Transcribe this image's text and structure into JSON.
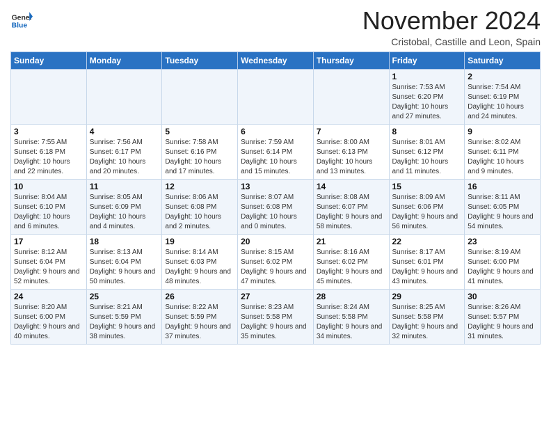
{
  "header": {
    "logo_general": "General",
    "logo_blue": "Blue",
    "month_title": "November 2024",
    "subtitle": "Cristobal, Castille and Leon, Spain"
  },
  "calendar": {
    "days_of_week": [
      "Sunday",
      "Monday",
      "Tuesday",
      "Wednesday",
      "Thursday",
      "Friday",
      "Saturday"
    ],
    "weeks": [
      [
        {
          "day": "",
          "info": ""
        },
        {
          "day": "",
          "info": ""
        },
        {
          "day": "",
          "info": ""
        },
        {
          "day": "",
          "info": ""
        },
        {
          "day": "",
          "info": ""
        },
        {
          "day": "1",
          "info": "Sunrise: 7:53 AM\nSunset: 6:20 PM\nDaylight: 10 hours and 27 minutes."
        },
        {
          "day": "2",
          "info": "Sunrise: 7:54 AM\nSunset: 6:19 PM\nDaylight: 10 hours and 24 minutes."
        }
      ],
      [
        {
          "day": "3",
          "info": "Sunrise: 7:55 AM\nSunset: 6:18 PM\nDaylight: 10 hours and 22 minutes."
        },
        {
          "day": "4",
          "info": "Sunrise: 7:56 AM\nSunset: 6:17 PM\nDaylight: 10 hours and 20 minutes."
        },
        {
          "day": "5",
          "info": "Sunrise: 7:58 AM\nSunset: 6:16 PM\nDaylight: 10 hours and 17 minutes."
        },
        {
          "day": "6",
          "info": "Sunrise: 7:59 AM\nSunset: 6:14 PM\nDaylight: 10 hours and 15 minutes."
        },
        {
          "day": "7",
          "info": "Sunrise: 8:00 AM\nSunset: 6:13 PM\nDaylight: 10 hours and 13 minutes."
        },
        {
          "day": "8",
          "info": "Sunrise: 8:01 AM\nSunset: 6:12 PM\nDaylight: 10 hours and 11 minutes."
        },
        {
          "day": "9",
          "info": "Sunrise: 8:02 AM\nSunset: 6:11 PM\nDaylight: 10 hours and 9 minutes."
        }
      ],
      [
        {
          "day": "10",
          "info": "Sunrise: 8:04 AM\nSunset: 6:10 PM\nDaylight: 10 hours and 6 minutes."
        },
        {
          "day": "11",
          "info": "Sunrise: 8:05 AM\nSunset: 6:09 PM\nDaylight: 10 hours and 4 minutes."
        },
        {
          "day": "12",
          "info": "Sunrise: 8:06 AM\nSunset: 6:08 PM\nDaylight: 10 hours and 2 minutes."
        },
        {
          "day": "13",
          "info": "Sunrise: 8:07 AM\nSunset: 6:08 PM\nDaylight: 10 hours and 0 minutes."
        },
        {
          "day": "14",
          "info": "Sunrise: 8:08 AM\nSunset: 6:07 PM\nDaylight: 9 hours and 58 minutes."
        },
        {
          "day": "15",
          "info": "Sunrise: 8:09 AM\nSunset: 6:06 PM\nDaylight: 9 hours and 56 minutes."
        },
        {
          "day": "16",
          "info": "Sunrise: 8:11 AM\nSunset: 6:05 PM\nDaylight: 9 hours and 54 minutes."
        }
      ],
      [
        {
          "day": "17",
          "info": "Sunrise: 8:12 AM\nSunset: 6:04 PM\nDaylight: 9 hours and 52 minutes."
        },
        {
          "day": "18",
          "info": "Sunrise: 8:13 AM\nSunset: 6:04 PM\nDaylight: 9 hours and 50 minutes."
        },
        {
          "day": "19",
          "info": "Sunrise: 8:14 AM\nSunset: 6:03 PM\nDaylight: 9 hours and 48 minutes."
        },
        {
          "day": "20",
          "info": "Sunrise: 8:15 AM\nSunset: 6:02 PM\nDaylight: 9 hours and 47 minutes."
        },
        {
          "day": "21",
          "info": "Sunrise: 8:16 AM\nSunset: 6:02 PM\nDaylight: 9 hours and 45 minutes."
        },
        {
          "day": "22",
          "info": "Sunrise: 8:17 AM\nSunset: 6:01 PM\nDaylight: 9 hours and 43 minutes."
        },
        {
          "day": "23",
          "info": "Sunrise: 8:19 AM\nSunset: 6:00 PM\nDaylight: 9 hours and 41 minutes."
        }
      ],
      [
        {
          "day": "24",
          "info": "Sunrise: 8:20 AM\nSunset: 6:00 PM\nDaylight: 9 hours and 40 minutes."
        },
        {
          "day": "25",
          "info": "Sunrise: 8:21 AM\nSunset: 5:59 PM\nDaylight: 9 hours and 38 minutes."
        },
        {
          "day": "26",
          "info": "Sunrise: 8:22 AM\nSunset: 5:59 PM\nDaylight: 9 hours and 37 minutes."
        },
        {
          "day": "27",
          "info": "Sunrise: 8:23 AM\nSunset: 5:58 PM\nDaylight: 9 hours and 35 minutes."
        },
        {
          "day": "28",
          "info": "Sunrise: 8:24 AM\nSunset: 5:58 PM\nDaylight: 9 hours and 34 minutes."
        },
        {
          "day": "29",
          "info": "Sunrise: 8:25 AM\nSunset: 5:58 PM\nDaylight: 9 hours and 32 minutes."
        },
        {
          "day": "30",
          "info": "Sunrise: 8:26 AM\nSunset: 5:57 PM\nDaylight: 9 hours and 31 minutes."
        }
      ]
    ]
  }
}
